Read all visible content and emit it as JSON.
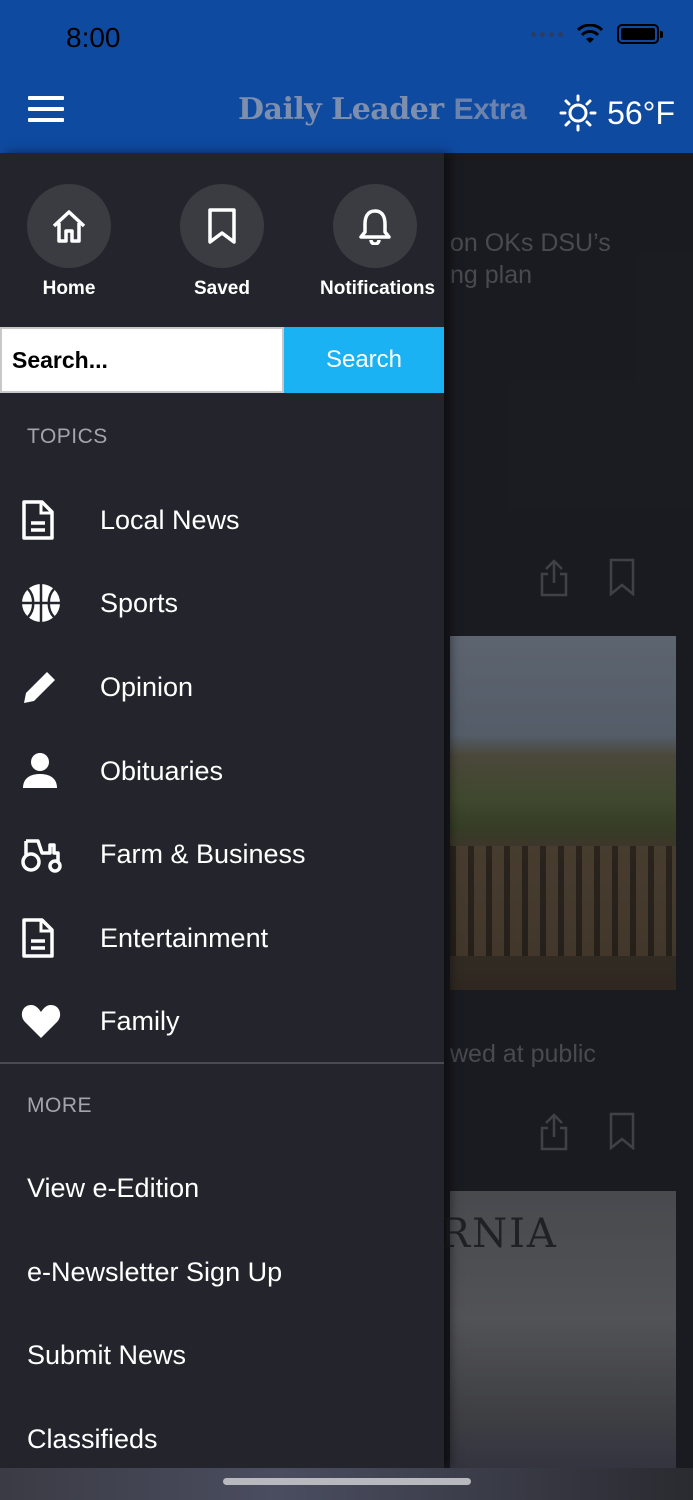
{
  "status_bar": {
    "time": "8:00"
  },
  "header": {
    "logo_main": "Daily Leader",
    "logo_extra": "Extra",
    "temperature": "56°F",
    "weather_icon": "sun-icon",
    "menu_icon": "hamburger-menu-icon"
  },
  "drawer": {
    "quick_actions": [
      {
        "label": "Home",
        "icon": "home-icon"
      },
      {
        "label": "Saved",
        "icon": "bookmark-icon"
      },
      {
        "label": "Notifications",
        "icon": "bell-icon"
      }
    ],
    "search": {
      "placeholder": "Search...",
      "button_label": "Search"
    },
    "topics_title": "TOPICS",
    "topics": [
      {
        "label": "Local News",
        "icon": "document-icon"
      },
      {
        "label": "Sports",
        "icon": "basketball-icon"
      },
      {
        "label": "Opinion",
        "icon": "pencil-icon"
      },
      {
        "label": "Obituaries",
        "icon": "person-icon"
      },
      {
        "label": "Farm & Business",
        "icon": "tractor-icon"
      },
      {
        "label": "Entertainment",
        "icon": "document-icon"
      },
      {
        "label": "Family",
        "icon": "heart-icon"
      }
    ],
    "more_title": "MORE",
    "more": [
      {
        "label": "View e-Edition"
      },
      {
        "label": "e-Newsletter Sign Up"
      },
      {
        "label": "Submit News"
      },
      {
        "label": "Classifieds"
      }
    ]
  },
  "background": {
    "headline_1_line_1": "on OKs DSU’s",
    "headline_1_line_2": "ng plan",
    "headline_2": "wed at public",
    "photo_2_text": "RNIA"
  },
  "colors": {
    "header_bg": "#0f4aa1",
    "drawer_bg": "#24252c",
    "search_button": "#1ab2f2"
  }
}
